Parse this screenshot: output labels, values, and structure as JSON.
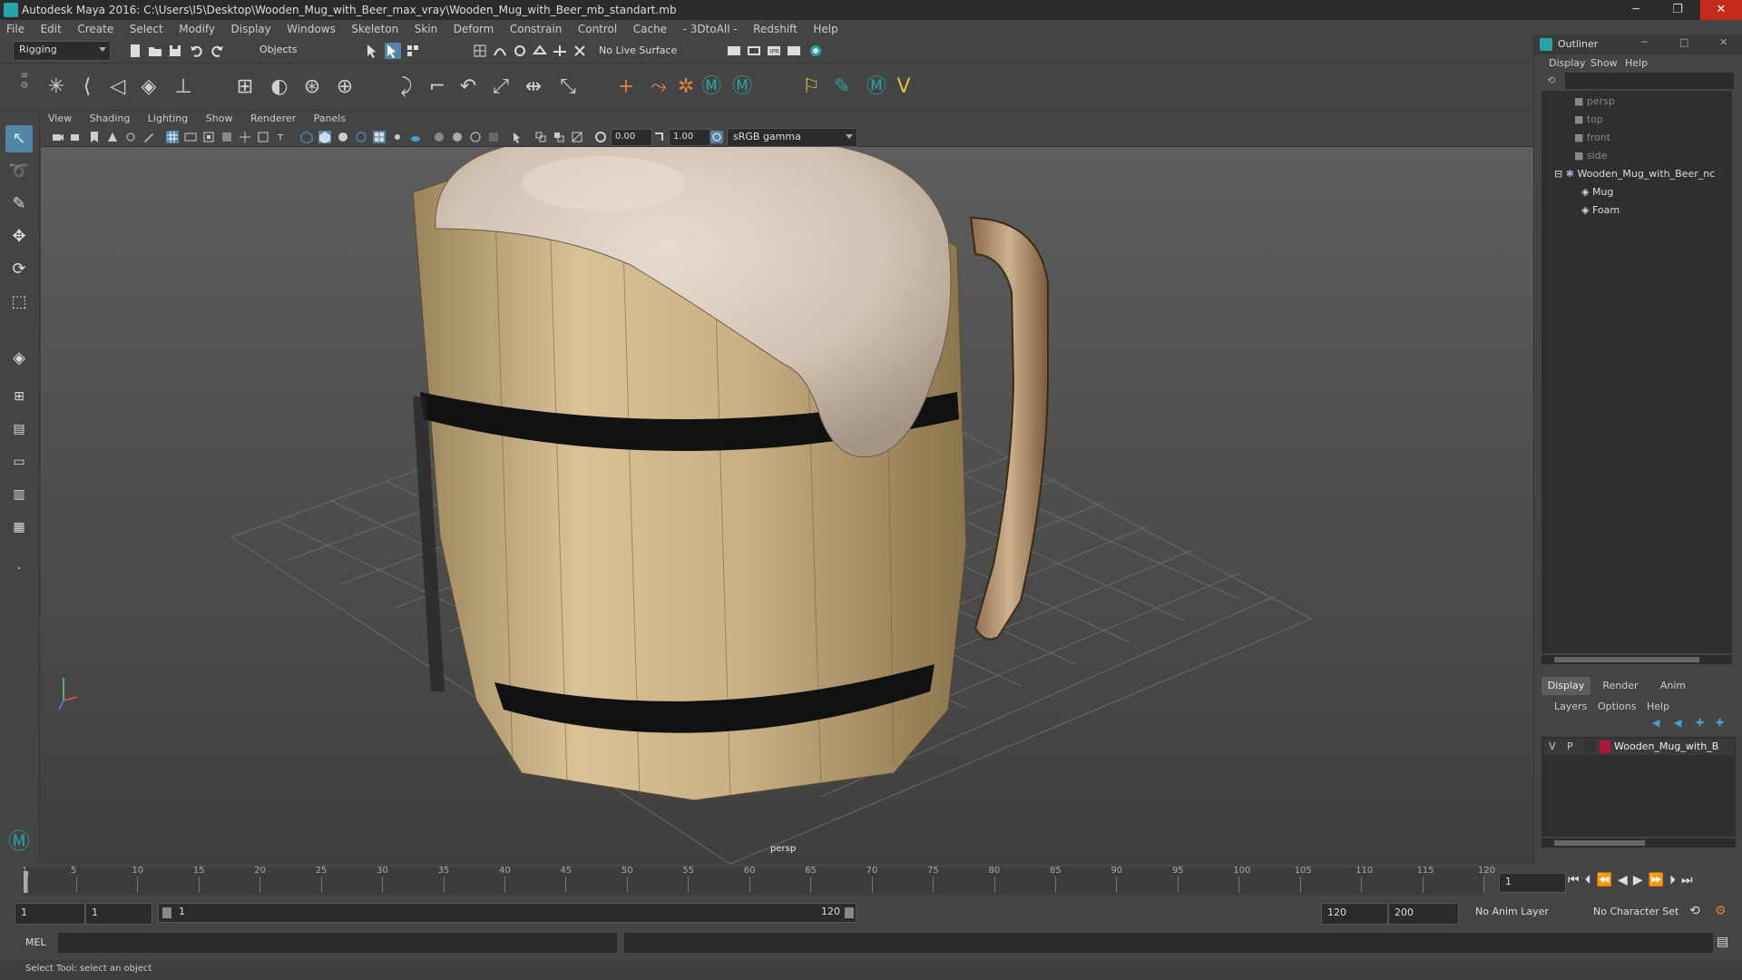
{
  "titlebar": {
    "title": "Autodesk Maya 2016: C:\\Users\\I5\\Desktop\\Wooden_Mug_with_Beer_max_vray\\Wooden_Mug_with_Beer_mb_standart.mb",
    "minimize": "─",
    "restore": "❐",
    "close": "✕"
  },
  "menubar": [
    "File",
    "Edit",
    "Create",
    "Select",
    "Modify",
    "Display",
    "Windows",
    "Skeleton",
    "Skin",
    "Deform",
    "Constrain",
    "Control",
    "Cache",
    "- 3DtoAll -",
    "Redshift",
    "Help"
  ],
  "statusline": {
    "menuset": "Rigging",
    "select_mode": "Objects",
    "live_surface": "No Live Surface"
  },
  "panel": {
    "menus": [
      "View",
      "Shading",
      "Lighting",
      "Show",
      "Renderer",
      "Panels"
    ],
    "exposure": "0.00",
    "gamma": "1.00",
    "color_space": "sRGB gamma",
    "camera_label": "persp"
  },
  "outliner": {
    "title": "Outliner",
    "menus": [
      "Display",
      "Show",
      "Help"
    ],
    "items": [
      {
        "label": "persp"
      },
      {
        "label": "top"
      },
      {
        "label": "front"
      },
      {
        "label": "side"
      },
      {
        "label": "Wooden_Mug_with_Beer_nc"
      },
      {
        "label": "Mug"
      },
      {
        "label": "Foam"
      }
    ]
  },
  "layer_editor": {
    "tabs": [
      "Display",
      "Render",
      "Anim"
    ],
    "menus": [
      "Layers",
      "Options",
      "Help"
    ],
    "layer": {
      "v": "V",
      "p": "P",
      "name": "Wooden_Mug_with_B",
      "color": "#b0153a"
    }
  },
  "timeline": {
    "ticks": [
      "1",
      "5",
      "10",
      "15",
      "20",
      "25",
      "30",
      "35",
      "40",
      "45",
      "50",
      "55",
      "60",
      "65",
      "70",
      "75",
      "80",
      "85",
      "90",
      "95",
      "100",
      "105",
      "110",
      "115",
      "120"
    ],
    "current_frame": "1"
  },
  "range": {
    "start": "1",
    "playback_start": "1",
    "slider_start": "1",
    "slider_end": "120",
    "playback_end": "120",
    "end": "200",
    "anim_layer": "No Anim Layer",
    "character_set": "No Character Set"
  },
  "cmdline": {
    "lang": "MEL"
  },
  "helpline": {
    "text": "Select Tool: select an object"
  },
  "colors": {
    "maya_teal": "#27a3a8",
    "accent_blue": "#5285a6",
    "layer_red": "#b0153a"
  }
}
